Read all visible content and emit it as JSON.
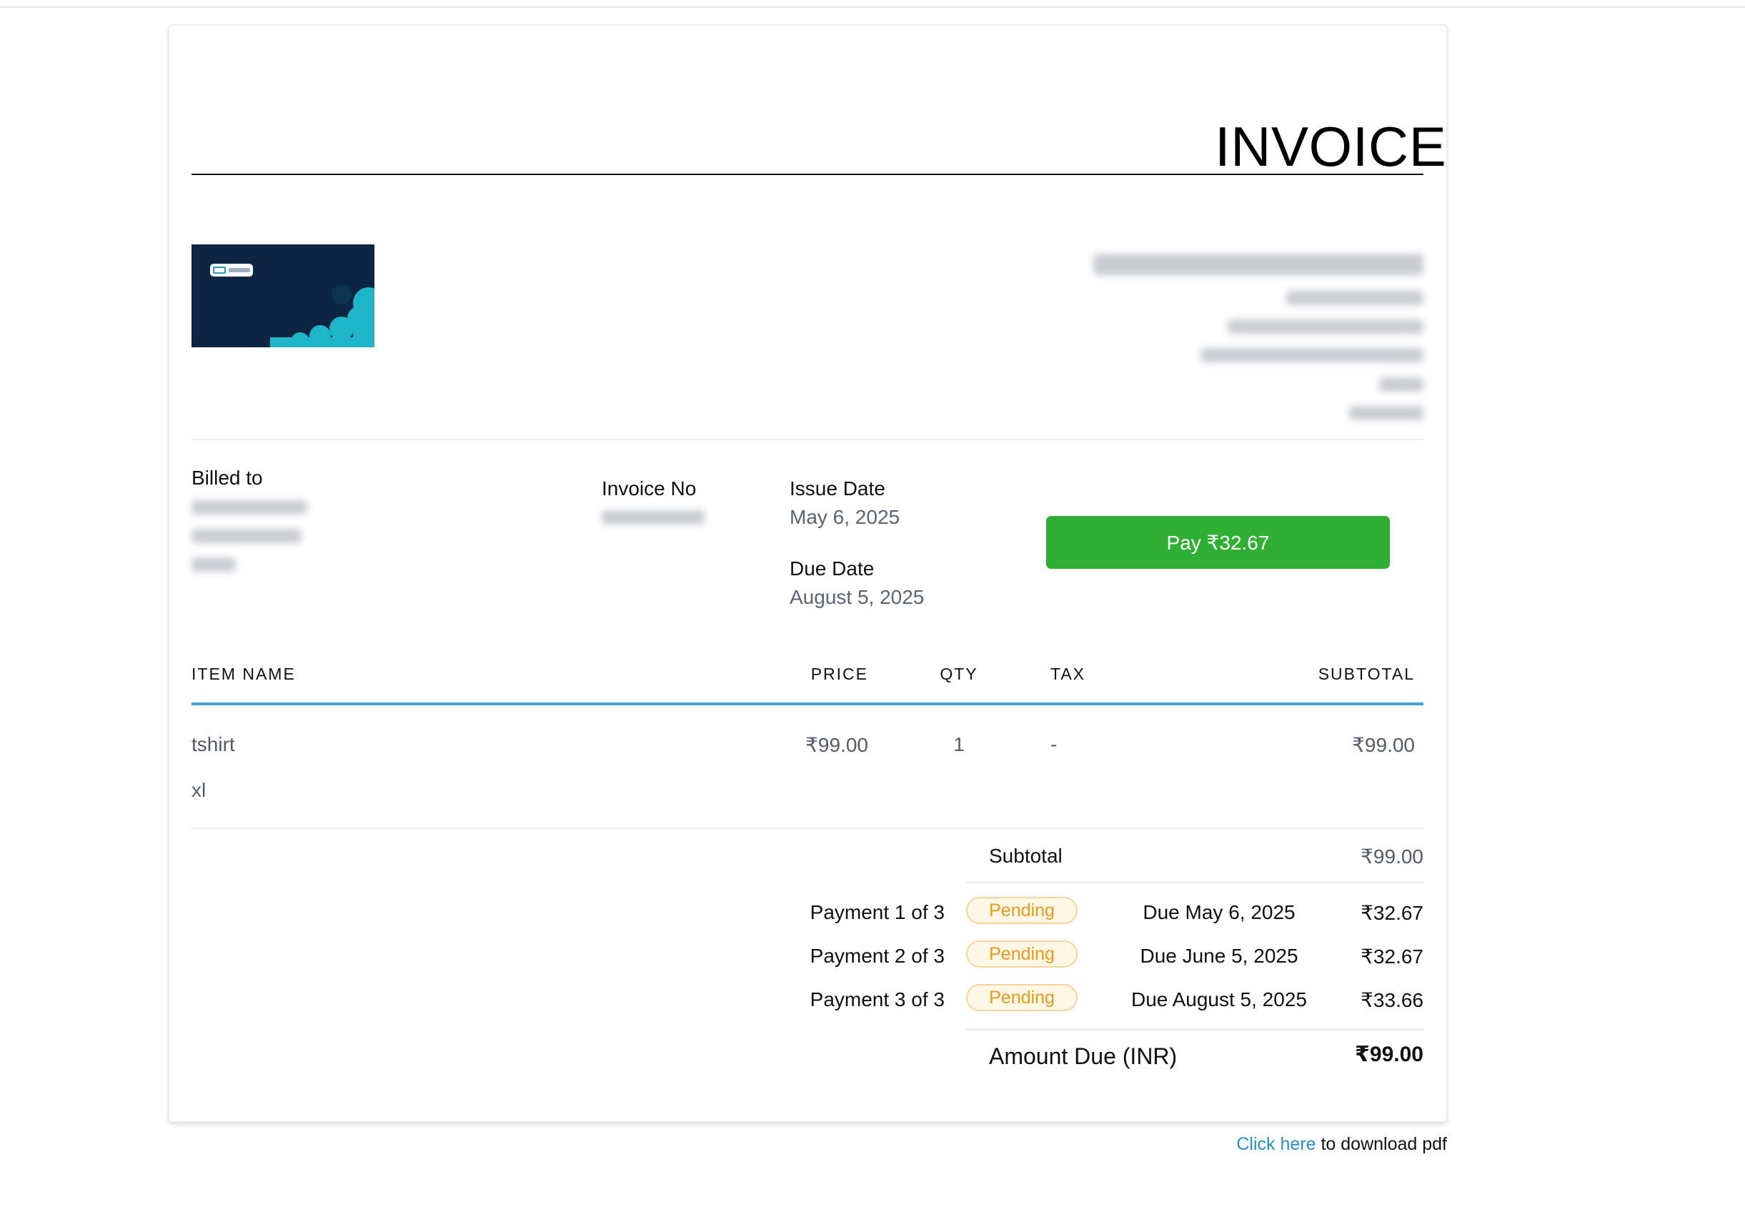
{
  "invoice": {
    "title": "INVOICE",
    "logo": {
      "label": "SMBcrm",
      "colors": {
        "background": "#0c2542",
        "cloud": "#1fb6c9"
      }
    },
    "billed_to_label": "Billed to",
    "invoice_no_label": "Invoice No",
    "issue_date_label": "Issue Date",
    "issue_date": "May 6, 2025",
    "due_date_label": "Due Date",
    "due_date": "August 5, 2025",
    "pay_button_label": "Pay ₹32.67",
    "table": {
      "headers": [
        "ITEM NAME",
        "PRICE",
        "QTY",
        "TAX",
        "SUBTOTAL"
      ],
      "rows": [
        {
          "name": "tshirt",
          "variant": "xl",
          "price": "₹99.00",
          "qty": "1",
          "tax": "-",
          "subtotal": "₹99.00"
        }
      ]
    },
    "subtotal_label": "Subtotal",
    "subtotal": "₹99.00",
    "payments": [
      {
        "label": "Payment 1 of 3",
        "status": "Pending",
        "due": "Due May 6, 2025",
        "amount": "₹32.67"
      },
      {
        "label": "Payment 2 of 3",
        "status": "Pending",
        "due": "Due June 5, 2025",
        "amount": "₹32.67"
      },
      {
        "label": "Payment 3 of 3",
        "status": "Pending",
        "due": "Due August 5, 2025",
        "amount": "₹33.66"
      }
    ],
    "amount_due_label": "Amount Due (INR)",
    "amount_due": "₹99.00",
    "colors": {
      "pay_button": "#2fb034",
      "pending_text": "#e69a17",
      "table_rule": "#4a9ed6",
      "link": "#2a8fc4"
    }
  },
  "footer": {
    "link_text": "Click here",
    "rest_text": " to download pdf"
  }
}
